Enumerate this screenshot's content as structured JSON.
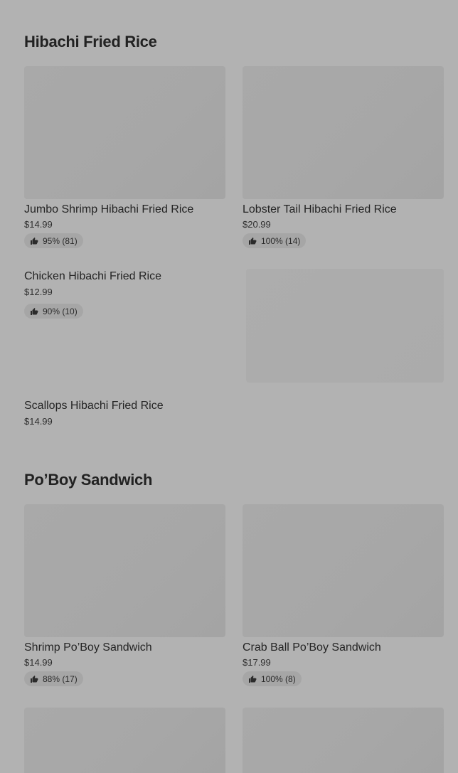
{
  "sections": [
    {
      "title": "Hibachi Fried Rice",
      "cards": [
        {
          "name": "Jumbo Shrimp Hibachi Fried Rice",
          "price": "$14.99",
          "rating": "95% (81)"
        },
        {
          "name": "Lobster Tail Hibachi Fried Rice",
          "price": "$20.99",
          "rating": "100% (14)"
        }
      ],
      "rows": [
        {
          "name": "Chicken Hibachi Fried Rice",
          "price": "$12.99",
          "rating": "90% (10)"
        },
        {
          "name": "Scallops Hibachi Fried Rice",
          "price": "$14.99"
        }
      ]
    },
    {
      "title": "Po’Boy Sandwich",
      "cards": [
        {
          "name": "Shrimp Po’Boy Sandwich",
          "price": "$14.99",
          "rating": "88% (17)"
        },
        {
          "name": "Crab Ball Po’Boy Sandwich",
          "price": "$17.99",
          "rating": "100% (8)"
        }
      ]
    }
  ],
  "icons": {
    "rating": "thumbs-up-icon",
    "item_photo": "food-photo"
  }
}
